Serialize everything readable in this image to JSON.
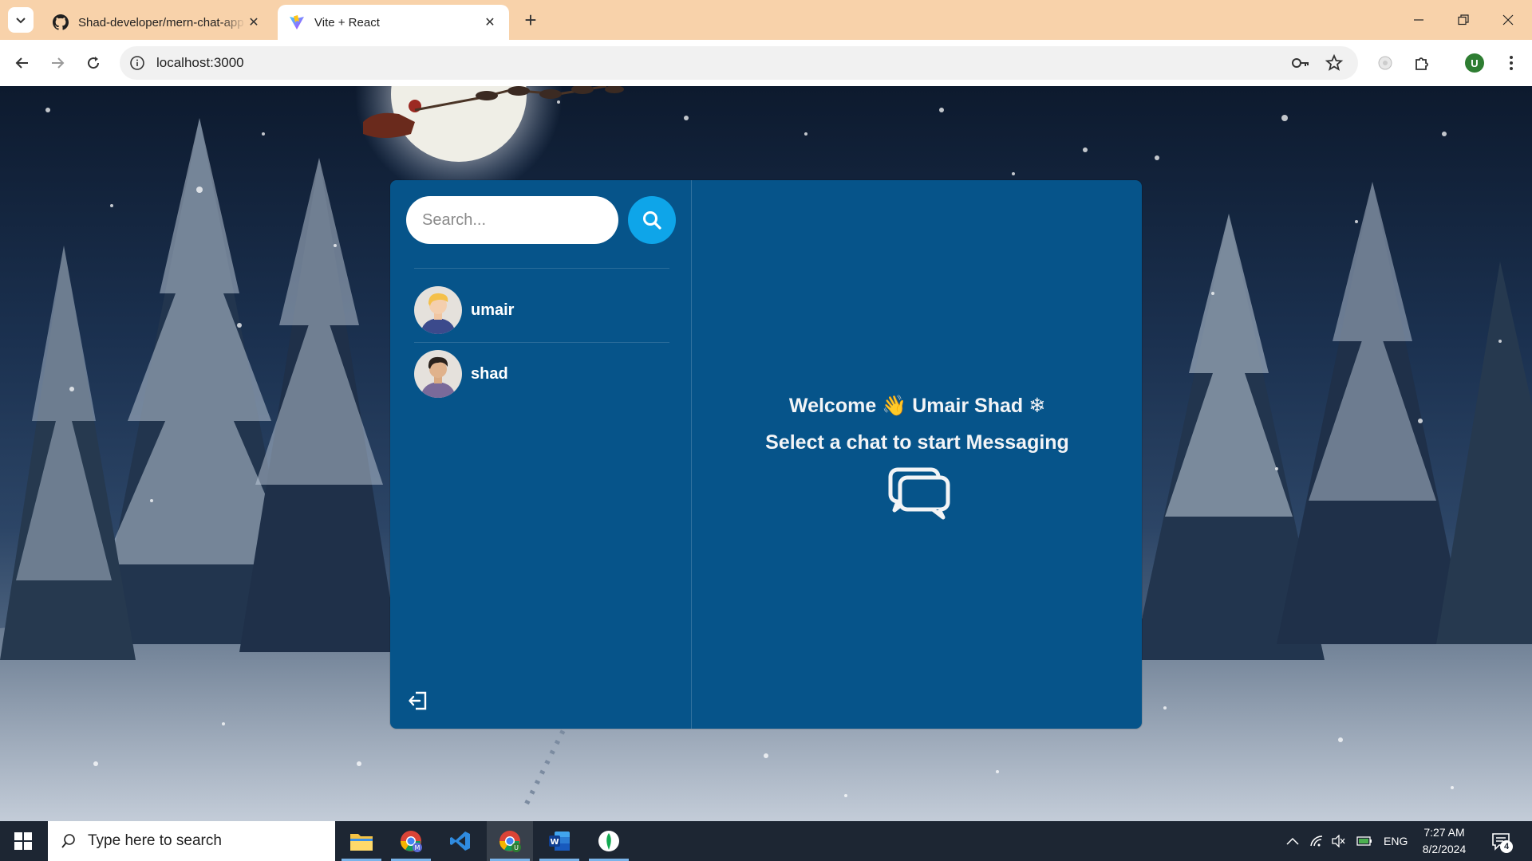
{
  "browser": {
    "tabs": [
      {
        "title": "Shad-developer/mern-chat-app",
        "favicon": "github-icon",
        "active": false
      },
      {
        "title": "Vite + React",
        "favicon": "vite-icon",
        "active": true
      }
    ],
    "address": "localhost:3000",
    "profile_initial": "U"
  },
  "app": {
    "search_placeholder": "Search...",
    "conversations": [
      {
        "name": "umair",
        "avatar": "avatar-boy-blonde"
      },
      {
        "name": "shad",
        "avatar": "avatar-boy-dark-hair"
      }
    ],
    "welcome_name_line": "Welcome 👋 Umair Shad ❄",
    "welcome_prompt": "Select a chat to start Messaging",
    "colors": {
      "panel": "#06548a",
      "search_button": "#0ea5e9",
      "text": "#f3f4f6"
    }
  },
  "taskbar": {
    "search_placeholder": "Type here to search",
    "apps": [
      "file-explorer-icon",
      "chrome-m-icon",
      "vscode-icon",
      "chrome-u-icon",
      "word-icon",
      "mongodb-compass-icon"
    ],
    "language": "ENG",
    "time": "7:27 AM",
    "date": "8/2/2024",
    "notification_count": "4"
  }
}
